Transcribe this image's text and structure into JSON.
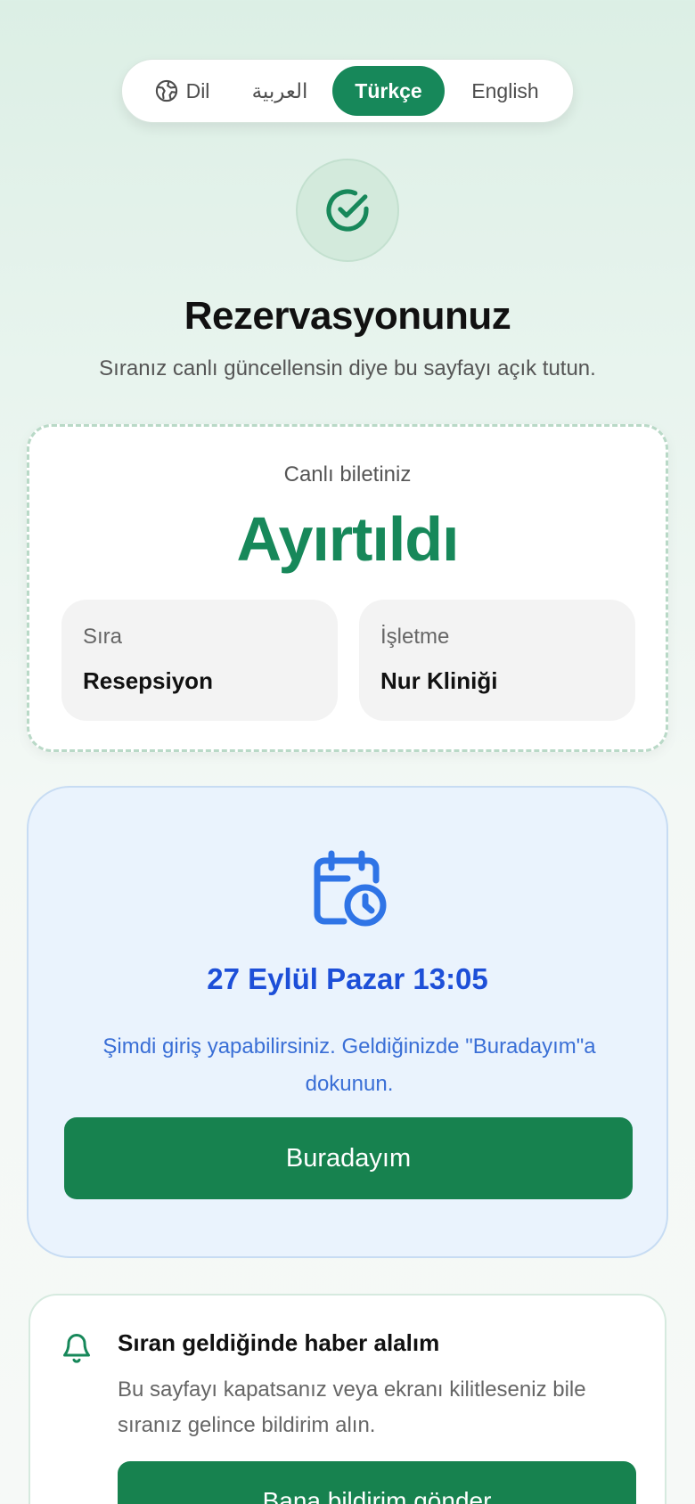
{
  "language_bar": {
    "label": "Dil",
    "options": [
      {
        "label": "العربية",
        "selected": false
      },
      {
        "label": "Türkçe",
        "selected": true
      },
      {
        "label": "English",
        "selected": false
      }
    ]
  },
  "header": {
    "title": "Rezervasyonunuz",
    "subtitle": "Sıranız canlı güncellensin diye bu sayfayı açık tutun."
  },
  "ticket": {
    "label": "Canlı biletiniz",
    "status": "Ayırtıldı",
    "queue": {
      "label": "Sıra",
      "value": "Resepsiyon"
    },
    "business": {
      "label": "İşletme",
      "value": "Nur Kliniği"
    }
  },
  "appointment": {
    "datetime": "27 Eylül Pazar 13:05",
    "message": "Şimdi giriş yapabilirsiniz. Geldiğinizde \"Buradayım\"a dokunun.",
    "button_label": "Buradayım"
  },
  "notify": {
    "title": "Sıran geldiğinde haber alalım",
    "description": "Bu sayfayı kapatsanız veya ekranı kilitleseniz bile sıranız gelince bildirim alın.",
    "button_label": "Bana bildirim gönder"
  },
  "colors": {
    "primary_green": "#17885a",
    "button_green": "#17824f",
    "blue_text": "#1d4fd8",
    "blue_panel": "#eaf3fd"
  },
  "icons": [
    "globe-icon",
    "check-circle-icon",
    "calendar-clock-icon",
    "bell-icon"
  ]
}
